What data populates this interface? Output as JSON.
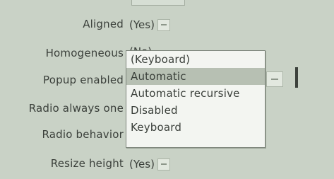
{
  "properties": [
    {
      "label": "Aligned",
      "value": "(Yes)"
    },
    {
      "label": "Homogeneous",
      "value": "(No)"
    },
    {
      "label": "Popup enabled",
      "value": ""
    },
    {
      "label": "Radio always one",
      "value": ""
    },
    {
      "label": "Radio behavior",
      "value": ""
    },
    {
      "label": "Resize height",
      "value": "(Yes)"
    }
  ],
  "popup_menu": {
    "items": [
      "(Keyboard)",
      "Automatic",
      "Automatic recursive",
      "Disabled",
      "Keyboard"
    ],
    "selected_index": 1
  },
  "colors": {
    "background": "#c9d2c6",
    "menu_background": "#f3f5f1",
    "menu_selected": "#b7c0b3"
  }
}
